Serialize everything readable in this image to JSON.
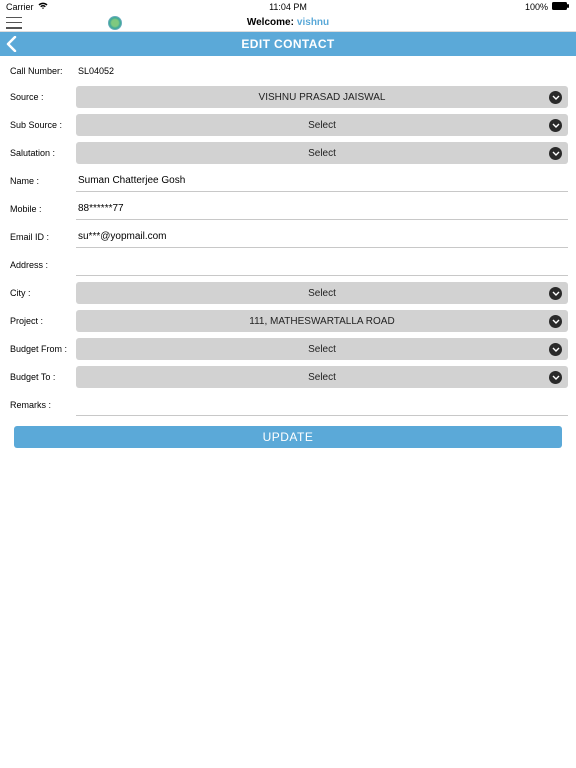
{
  "status": {
    "carrier": "Carrier",
    "time": "11:04 PM",
    "battery": "100%"
  },
  "welcome": {
    "prefix": "Welcome:",
    "user": "vishnu"
  },
  "header": {
    "title": "EDIT CONTACT"
  },
  "callnum": {
    "label": "Call Number:",
    "value": "SL04052"
  },
  "fields": {
    "source": {
      "label": "Source :",
      "value": "VISHNU PRASAD JAISWAL"
    },
    "subsource": {
      "label": "Sub Source :",
      "value": "Select"
    },
    "salutation": {
      "label": "Salutation :",
      "value": "Select"
    },
    "name": {
      "label": "Name :",
      "value": "Suman Chatterjee Gosh"
    },
    "mobile": {
      "label": "Mobile :",
      "value": "88******77"
    },
    "email": {
      "label": "Email ID :",
      "value": "su***@yopmail.com"
    },
    "address": {
      "label": "Address :",
      "value": ""
    },
    "city": {
      "label": "City :",
      "value": "Select"
    },
    "project": {
      "label": "Project :",
      "value": "111, MATHESWARTALLA ROAD"
    },
    "budgetfrom": {
      "label": "Budget From :",
      "value": "Select"
    },
    "budgetto": {
      "label": "Budget To :",
      "value": "Select"
    },
    "remarks": {
      "label": "Remarks :",
      "value": ""
    }
  },
  "update": {
    "label": "UPDATE"
  }
}
